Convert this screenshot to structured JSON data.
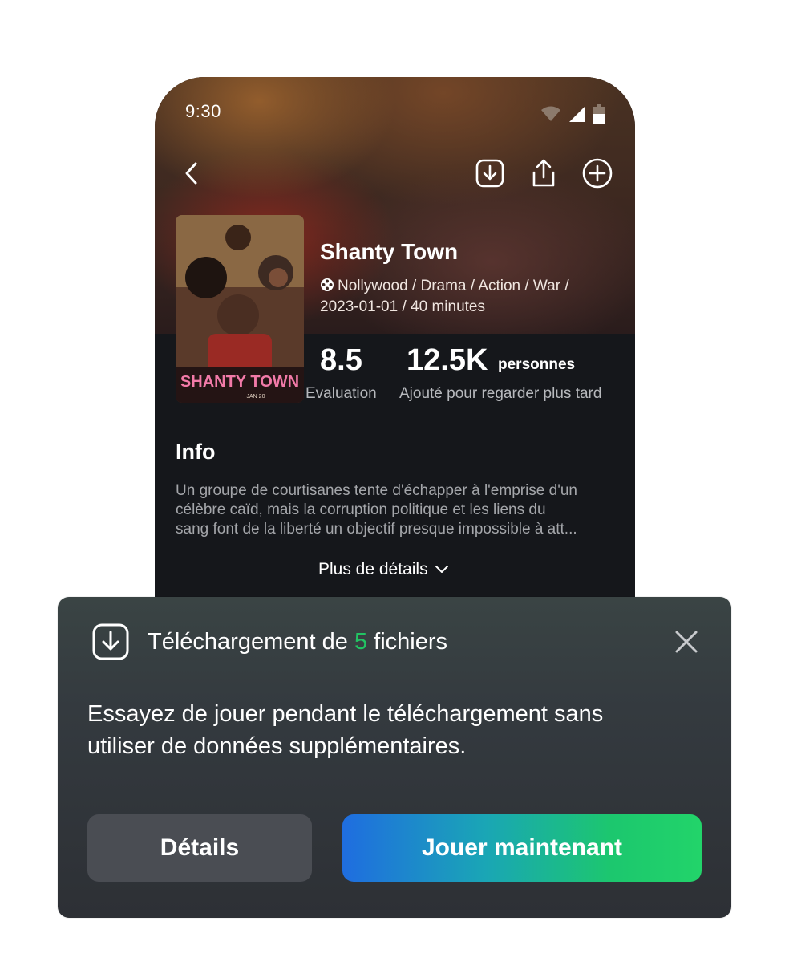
{
  "status_bar": {
    "time": "9:30"
  },
  "header_actions": {
    "back_icon": "chevron-left-icon",
    "download_icon": "download-icon",
    "share_icon": "share-icon",
    "add_icon": "plus-circle-icon"
  },
  "movie": {
    "title": "Shanty Town",
    "poster_text": "SHANTY TOWN",
    "poster_date": "JAN 20",
    "meta_line1": "Nollywood / Drama / Action / War /",
    "meta_line2_date": "2023-01-01 / 40",
    "meta_line2_unit": "minutes",
    "rating_value": "8.5",
    "rating_label": "Evaluation",
    "watchlist_count": "12.5K",
    "watchlist_unit": "personnes",
    "watchlist_label": "Ajouté pour regarder plus tard"
  },
  "info": {
    "heading": "Info",
    "line1": "Un groupe de courtisanes tente d'échapper à l'emprise d'un",
    "line2": "célèbre caïd, mais la corruption politique et les liens du",
    "line3": "sang font de la liberté un objectif presque impossible à att...",
    "more_label": "Plus de détails"
  },
  "dialog": {
    "title_prefix": "Téléchargement de",
    "file_count": "5",
    "title_suffix": "fichiers",
    "body_line1": "Essayez de jouer pendant le téléchargement sans",
    "body_line2": "utiliser de données supplémentaires.",
    "details_label": "Détails",
    "play_label": "Jouer maintenant"
  },
  "colors": {
    "accent_green": "#22c463",
    "play_gradient_start": "#1f6de0",
    "play_gradient_end": "#22d46a",
    "dialog_bg": "#2d3035"
  }
}
